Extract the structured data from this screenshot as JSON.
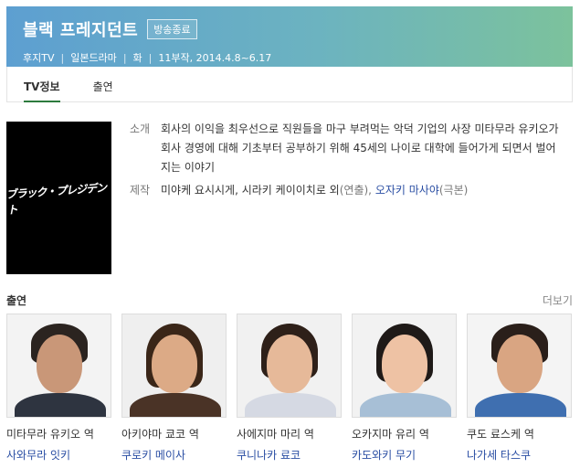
{
  "header": {
    "title": "블랙 프레지던트",
    "badge": "방송종료",
    "broadcaster": "후지TV",
    "genre": "일본드라마",
    "day": "화",
    "schedule": "11부작, 2014.4.8~6.17"
  },
  "tabs": [
    {
      "label": "TV정보",
      "active": true
    },
    {
      "label": "출연",
      "active": false
    }
  ],
  "poster": {
    "title_text": "ブラック・プレジデント"
  },
  "info": {
    "synopsis_label": "소개",
    "synopsis": "회사의 이익을 최우선으로 직원들을 마구 부려먹는 악덕 기업의 사장 미타무라 유키오가 회사 경영에 대해 기초부터 공부하기 위해 45세의 나이로 대학에 들어가게 되면서 벌어지는 이야기",
    "staff_label": "제작",
    "directors": "미야케 요시시게, 시라키 케이이치로 외",
    "directors_role": "(연출),",
    "writer": "오자키 마사야",
    "writer_role": "(극본)"
  },
  "cast_section": {
    "title": "출연",
    "more": "더보기",
    "members": [
      {
        "role": "미타무라 유키오 역",
        "actor": "사와무라 잇키"
      },
      {
        "role": "아키야마 쿄코 역",
        "actor": "쿠로키 메이사"
      },
      {
        "role": "사에지마 마리 역",
        "actor": "쿠니나카 료코"
      },
      {
        "role": "오카지마 유리 역",
        "actor": "카도와키 무기"
      },
      {
        "role": "쿠도 료스케 역",
        "actor": "나가세 타스쿠"
      }
    ]
  },
  "colors": {
    "header_gradient_start": "#5d9fd1",
    "header_gradient_end": "#7cc29c",
    "tab_underline": "#2d7b3e",
    "link": "#2a4ea3"
  }
}
